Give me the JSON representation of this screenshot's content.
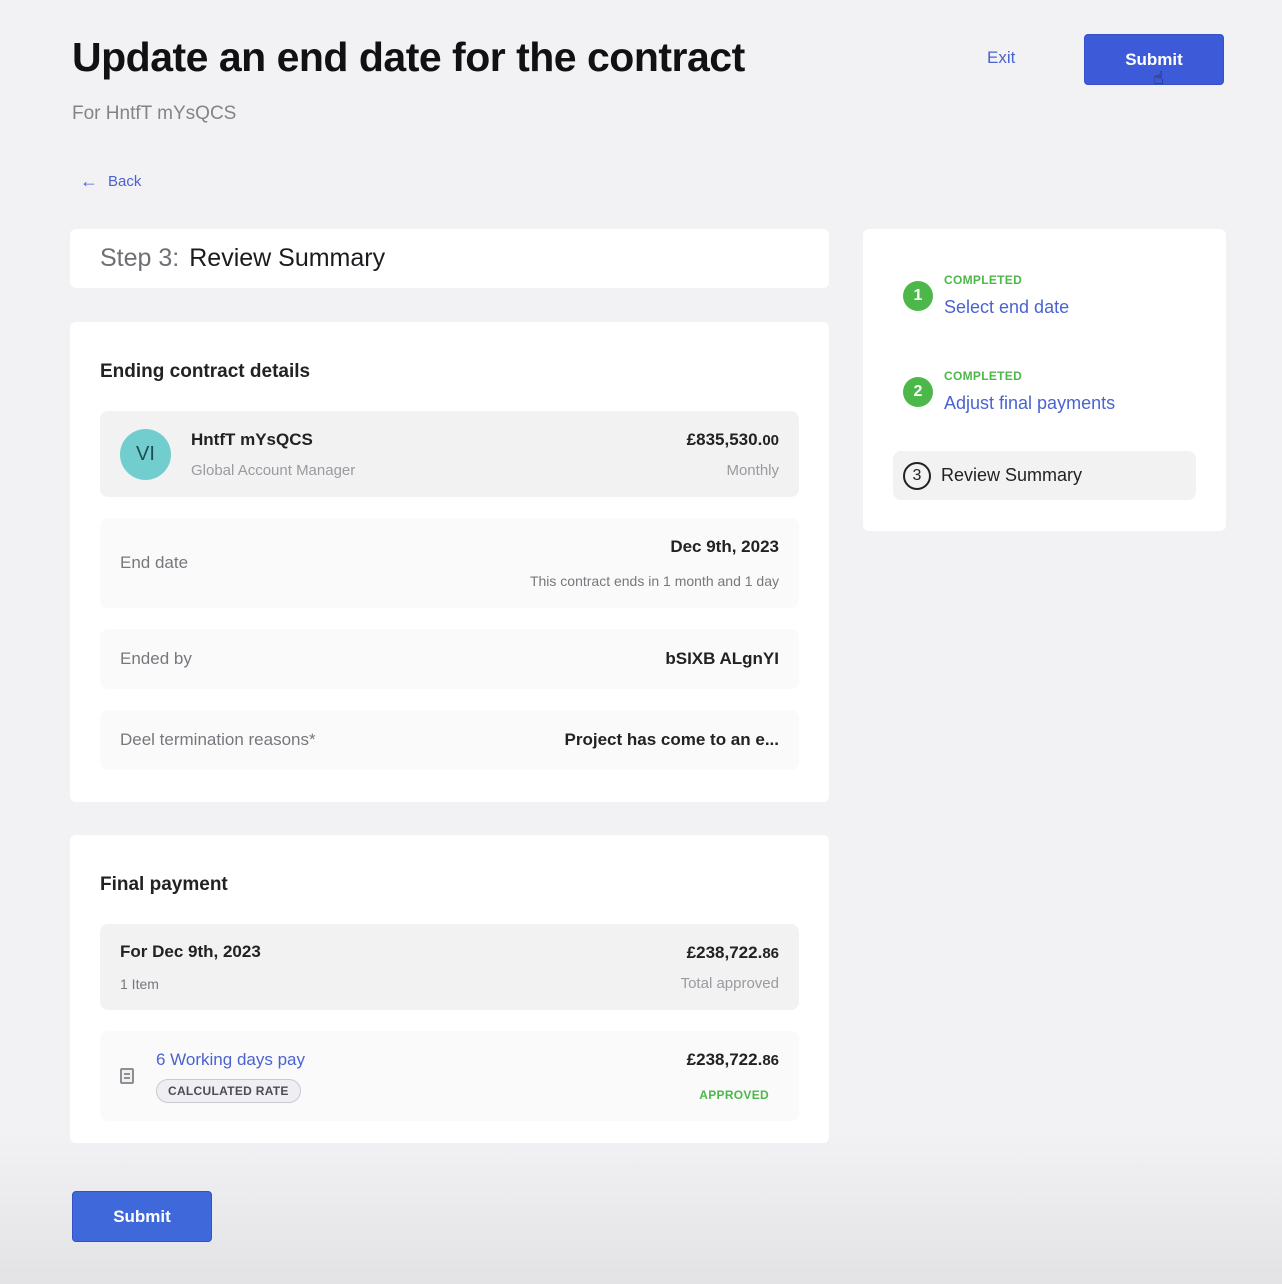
{
  "header": {
    "title": "Update an end date for the contract",
    "subtitle": "For HntfT mYsQCS",
    "exit_label": "Exit",
    "submit_label": "Submit",
    "back_label": "Back"
  },
  "step_header": {
    "step_number": "Step 3:",
    "step_name": "Review Summary"
  },
  "ending_contract": {
    "title": "Ending contract details",
    "person": {
      "initials": "VI",
      "name": "HntfT mYsQCS",
      "role": "Global Account Manager",
      "amount_main": "£835,530.",
      "amount_cents": "00",
      "frequency": "Monthly",
      "avatar_color": "#72cece"
    },
    "end_date": {
      "label": "End date",
      "value": "Dec 9th, 2023",
      "hint": "This contract ends in 1 month and 1 day"
    },
    "ended_by": {
      "label": "Ended by",
      "value": "bSIXB ALgnYI"
    },
    "termination_reason": {
      "label": "Deel termination reasons*",
      "value": "Project has come to an e..."
    }
  },
  "final_payment": {
    "title": "Final payment",
    "header": {
      "date_label": "For Dec 9th, 2023",
      "item_count": "1 Item",
      "amount_main": "£238,722.",
      "amount_cents": "86",
      "amount_label": "Total approved"
    },
    "items": [
      {
        "title": "6 Working days pay",
        "badge": "CALCULATED RATE",
        "amount_main": "£238,722.",
        "amount_cents": "86",
        "status": "APPROVED",
        "icon": "document-icon"
      }
    ]
  },
  "stepper": {
    "steps": [
      {
        "number": "1",
        "status": "COMPLETED",
        "label": "Select end date"
      },
      {
        "number": "2",
        "status": "COMPLETED",
        "label": "Adjust final payments"
      },
      {
        "number": "3",
        "status": "",
        "label": "Review Summary"
      }
    ]
  },
  "footer": {
    "submit_label": "Submit"
  },
  "colors": {
    "primary": "#3d5bd9",
    "link": "#4a63d0",
    "success": "#4db84a",
    "background": "#f2f2f5"
  }
}
